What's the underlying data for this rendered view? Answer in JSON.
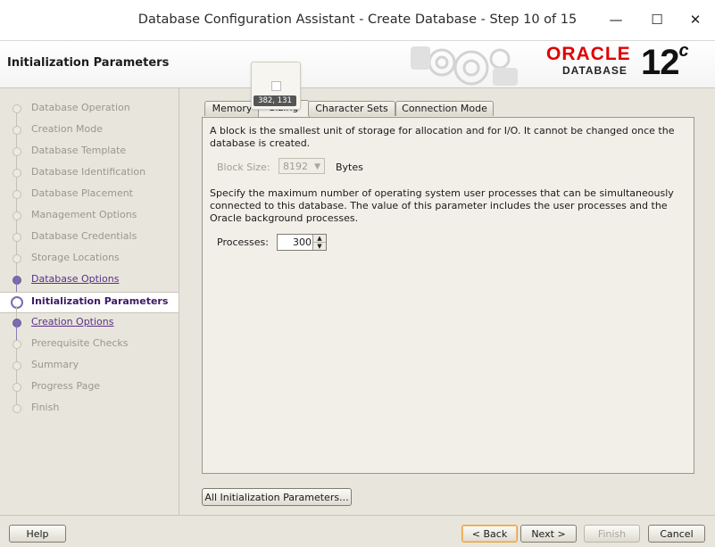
{
  "window": {
    "title": "Database Configuration Assistant - Create Database - Step 10 of 15",
    "minimize_icon": "minimize-icon",
    "maximize_icon": "maximize-icon",
    "close_icon": "close-icon"
  },
  "header": {
    "page_title": "Initialization Parameters",
    "logo_oracle": "ORACLE",
    "logo_database": "DATABASE",
    "version": "12",
    "version_sup": "c"
  },
  "sidebar": {
    "steps": [
      {
        "label": "Database Operation",
        "state": "pending"
      },
      {
        "label": "Creation Mode",
        "state": "pending"
      },
      {
        "label": "Database Template",
        "state": "pending"
      },
      {
        "label": "Database Identification",
        "state": "pending"
      },
      {
        "label": "Database Placement",
        "state": "pending"
      },
      {
        "label": "Management Options",
        "state": "pending"
      },
      {
        "label": "Database Credentials",
        "state": "pending"
      },
      {
        "label": "Storage Locations",
        "state": "pending"
      },
      {
        "label": "Database Options",
        "state": "done"
      },
      {
        "label": "Initialization Parameters",
        "state": "current"
      },
      {
        "label": "Creation Options",
        "state": "done"
      },
      {
        "label": "Prerequisite Checks",
        "state": "pending"
      },
      {
        "label": "Summary",
        "state": "pending"
      },
      {
        "label": "Progress Page",
        "state": "pending"
      },
      {
        "label": "Finish",
        "state": "pending"
      }
    ]
  },
  "tabs": [
    {
      "label": "Memory",
      "active": false
    },
    {
      "label": "Sizing",
      "active": true
    },
    {
      "label": "Character Sets",
      "active": false
    },
    {
      "label": "Connection Mode",
      "active": false
    }
  ],
  "sizing": {
    "block_desc": "A block is the smallest unit of storage for allocation and for I/O. It cannot be changed once the database is created.",
    "block_size_label": "Block Size:",
    "block_size_value": "8192",
    "block_size_unit": "Bytes",
    "processes_desc": "Specify the maximum number of operating system user processes that can be simultaneously connected to this database. The value of this parameter includes the user processes and the Oracle background processes.",
    "processes_label": "Processes:",
    "processes_value": "300"
  },
  "buttons": {
    "all_params": "All Initialization Parameters...",
    "help": "Help",
    "back": "< Back",
    "next": "Next >",
    "finish": "Finish",
    "cancel": "Cancel"
  },
  "overlay": {
    "coord_text": "382, 131"
  }
}
